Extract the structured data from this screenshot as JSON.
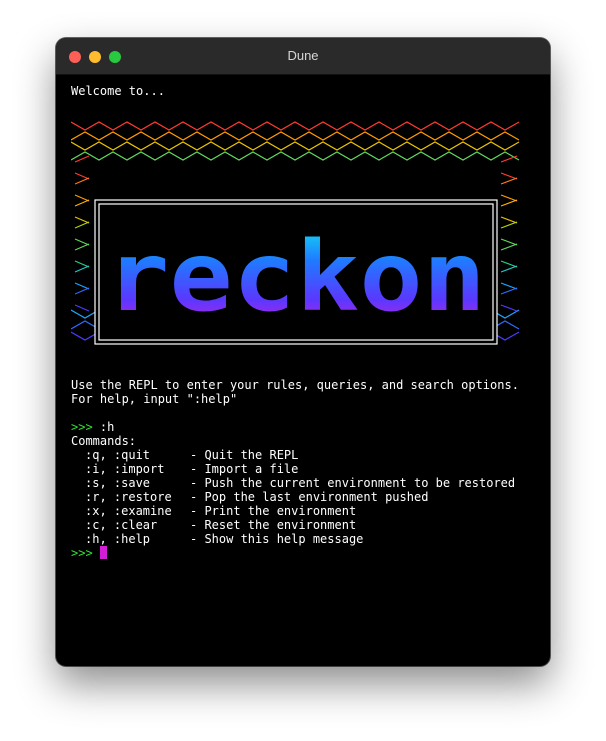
{
  "window": {
    "title": "Dune"
  },
  "terminal": {
    "welcome": "Welcome to...",
    "logo": "reckon",
    "intro_line1": "Use the REPL to enter your rules, queries, and search options.",
    "intro_line2": "For help, input \":help\"",
    "prompt": ">>>",
    "command": ":h",
    "commands_header": "Commands:",
    "commands": [
      {
        "keys": ":q, :quit",
        "desc": "Quit the REPL"
      },
      {
        "keys": ":i, :import",
        "desc": "Import a file"
      },
      {
        "keys": ":s, :save",
        "desc": "Push the current environment to be restored"
      },
      {
        "keys": ":r, :restore",
        "desc": "Pop the last environment pushed"
      },
      {
        "keys": ":x, :examine",
        "desc": "Print the environment"
      },
      {
        "keys": ":c, :clear",
        "desc": "Reset the environment"
      },
      {
        "keys": ":h, :help",
        "desc": "Show this help message"
      }
    ]
  },
  "colors": {
    "prompt": "#35e035",
    "cursor": "#d21fd6",
    "hex_rainbow": [
      "#ff3b30",
      "#ff7a1a",
      "#ff9a00",
      "#ffb000",
      "#e8c400",
      "#b7d400",
      "#5ed65e",
      "#26d18a",
      "#1fc9c9",
      "#1aa6ff",
      "#2b6bff",
      "#4d3bff"
    ],
    "logo_gradient": [
      "#10e8f0",
      "#1f7bff",
      "#5a38ff",
      "#d21fd6"
    ]
  }
}
